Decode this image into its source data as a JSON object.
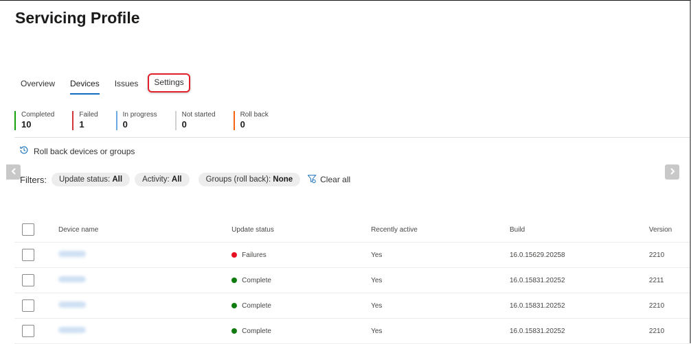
{
  "page": {
    "title": "Servicing Profile"
  },
  "tabs": [
    {
      "label": "Overview",
      "active": false
    },
    {
      "label": "Devices",
      "active": true
    },
    {
      "label": "Issues",
      "active": false
    },
    {
      "label": "Settings",
      "active": false,
      "highlighted": true
    }
  ],
  "stats": [
    {
      "label": "Completed",
      "value": "10",
      "color": "#13a10e"
    },
    {
      "label": "Failed",
      "value": "1",
      "color": "#d13438"
    },
    {
      "label": "In progress",
      "value": "0",
      "color": "#69a9e0"
    },
    {
      "label": "Not started",
      "value": "0",
      "color": "#d2d0ce"
    },
    {
      "label": "Roll back",
      "value": "0",
      "color": "#f7630c"
    }
  ],
  "rollback": {
    "label": "Roll back devices or groups",
    "icon": "history-icon"
  },
  "filters": {
    "label": "Filters:",
    "pills": [
      {
        "name": "Update status:",
        "value": "All"
      },
      {
        "name": "Activity:",
        "value": "All"
      },
      {
        "name": "Groups (roll back):",
        "value": "None"
      }
    ],
    "clear_label": "Clear all"
  },
  "table": {
    "columns": [
      "Device name",
      "Update status",
      "Recently active",
      "Build",
      "Version"
    ],
    "rows": [
      {
        "device": "[redacted]",
        "status": "Failures",
        "status_color": "#e81123",
        "active": "Yes",
        "build": "16.0.15629.20258",
        "version": "2210"
      },
      {
        "device": "[redacted]",
        "status": "Complete",
        "status_color": "#107c10",
        "active": "Yes",
        "build": "16.0.15831.20252",
        "version": "2211"
      },
      {
        "device": "[redacted]",
        "status": "Complete",
        "status_color": "#107c10",
        "active": "Yes",
        "build": "16.0.15831.20252",
        "version": "2210"
      },
      {
        "device": "[redacted]",
        "status": "Complete",
        "status_color": "#107c10",
        "active": "Yes",
        "build": "16.0.15831.20252",
        "version": "2210"
      }
    ]
  }
}
